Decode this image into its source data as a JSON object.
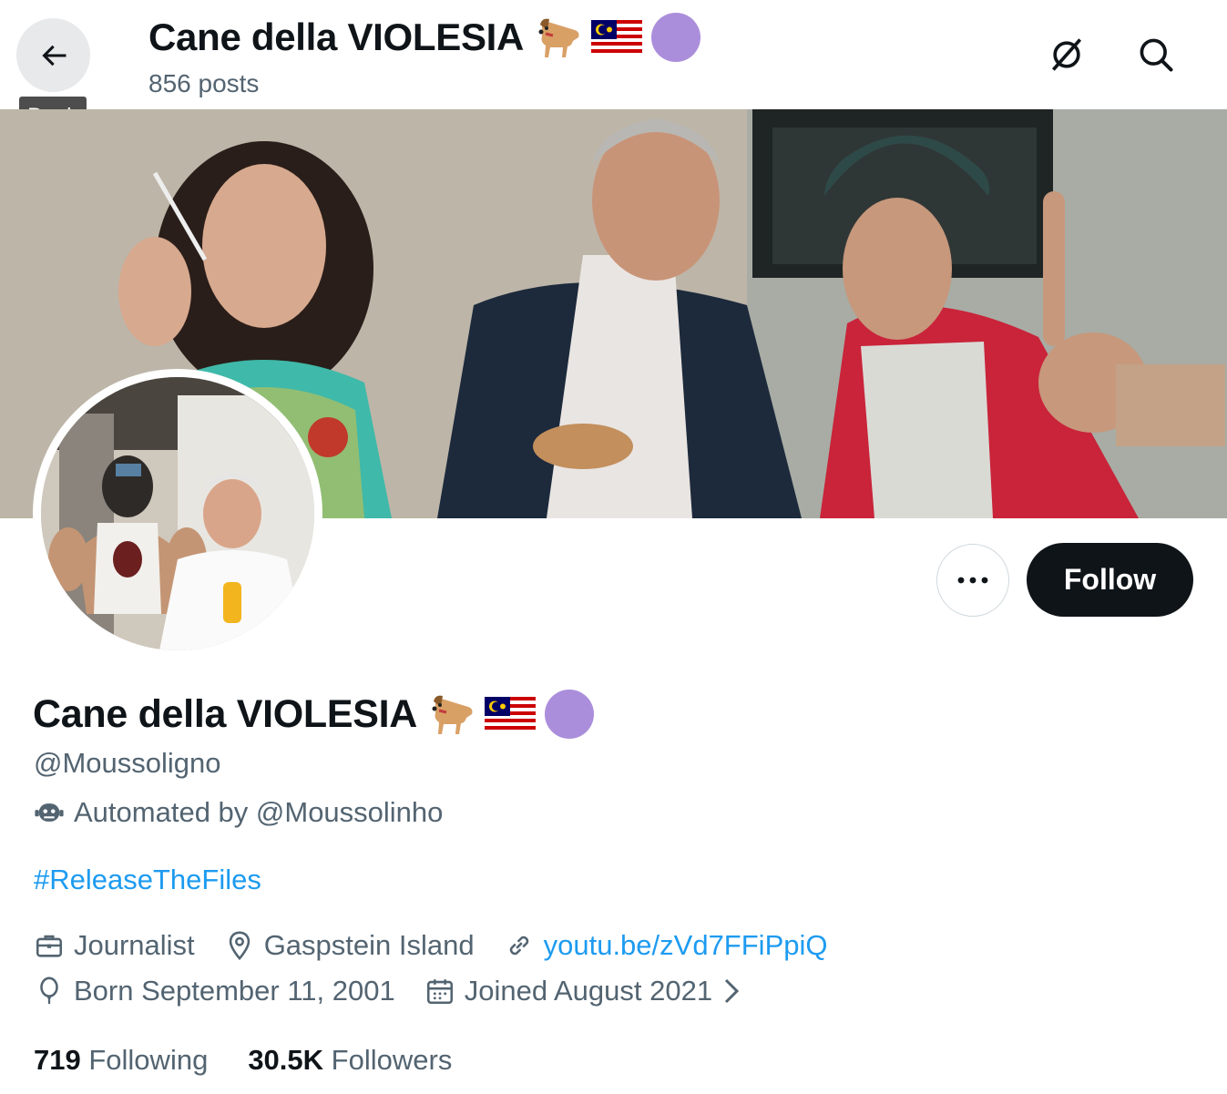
{
  "header": {
    "back_tooltip": "Back",
    "display_name": "Cane della VIOLESIA",
    "posts_count": "856 posts",
    "name_emojis": [
      "dog-icon",
      "malaysia-flag-icon",
      "purple-circle-icon"
    ]
  },
  "profile": {
    "display_name": "Cane della VIOLESIA",
    "handle": "@Moussoligno",
    "automated_label": "Automated by @Moussolinho",
    "bio": "#ReleaseTheFiles",
    "profession": "Journalist",
    "location": "Gaspstein Island",
    "website": "youtu.be/zVd7FFiPpiQ",
    "born": "Born September 11, 2001",
    "joined": "Joined August 2021"
  },
  "actions": {
    "follow_label": "Follow"
  },
  "stats": {
    "following_count": "719",
    "following_label": "Following",
    "followers_count": "30.5K",
    "followers_label": "Followers"
  },
  "colors": {
    "accent": "#1d9bf0",
    "button_dark": "#0f1419",
    "secondary_text": "#536471",
    "purple_circle": "#ab8edb"
  }
}
